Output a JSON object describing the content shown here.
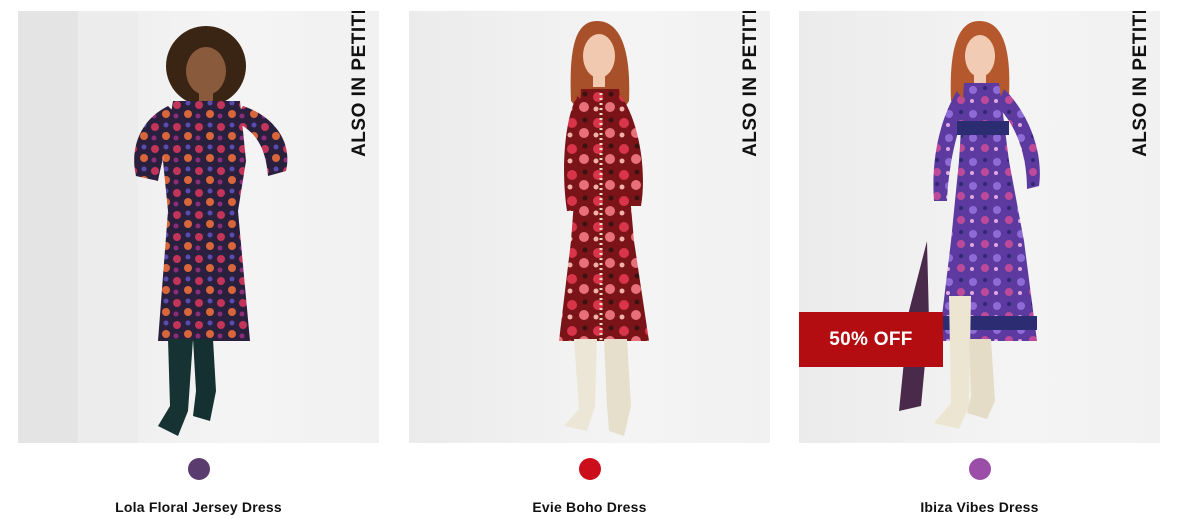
{
  "products": [
    {
      "name": "Lola Floral Jersey Dress",
      "badge": "ALSO IN PETITE",
      "swatch_color": "#5a3d6e",
      "sale_label": null
    },
    {
      "name": "Evie Boho Dress",
      "badge": "ALSO IN PETITE",
      "swatch_color": "#cc0e1c",
      "sale_label": null
    },
    {
      "name": "Ibiza Vibes Dress",
      "badge": "ALSO IN PETITE",
      "swatch_color": "#9b4ea8",
      "sale_label": "50% OFF"
    }
  ],
  "colors": {
    "sale_background": "#b30d12",
    "sale_text": "#ffffff",
    "badge_text": "#111111"
  }
}
